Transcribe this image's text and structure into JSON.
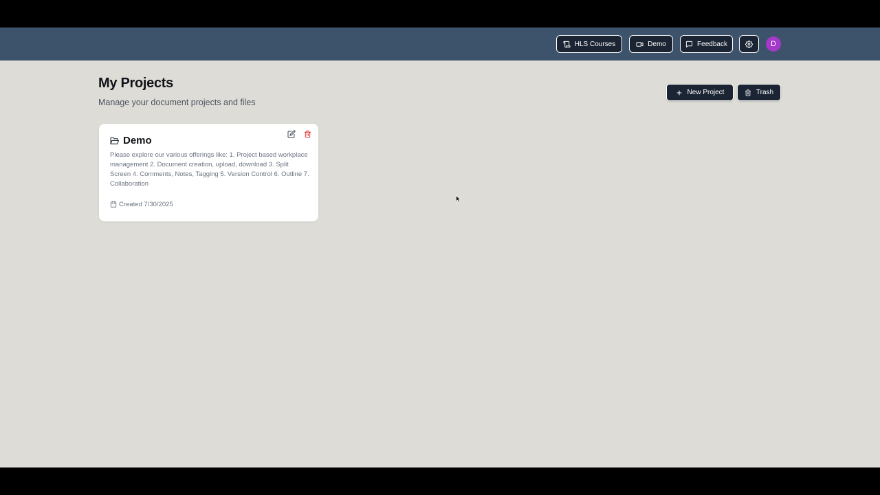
{
  "header": {
    "hls_courses_label": "HLS Courses",
    "demo_label": "Demo",
    "feedback_label": "Feedback",
    "avatar_initial": "D"
  },
  "page": {
    "title": "My Projects",
    "subtitle": "Manage your document projects and files",
    "new_project_label": "New Project",
    "trash_label": "Trash"
  },
  "projects": [
    {
      "title": "Demo",
      "description": "Please explore our various offerings like: 1. Project based workplace management 2. Document creation, upload, download 3. Split Screen 4. Comments, Notes, Tagging 5. Version Control 6. Outline 7. Collaboration",
      "created": "Created 7/30/2025"
    }
  ],
  "colors": {
    "topbar": "#3d526b",
    "background": "#dddcd6",
    "button_dark": "#1b2433",
    "avatar": "#a338c9",
    "delete_red": "#dc2626"
  },
  "icons": {
    "hls_courses": "scroll-icon",
    "demo": "video-icon",
    "feedback": "message-square-icon",
    "settings": "gear-icon",
    "new_project": "plus-icon",
    "trash": "trash-icon",
    "card_folder": "folder-open-icon",
    "card_edit": "edit-icon",
    "card_delete": "trash-icon",
    "card_created": "calendar-icon"
  }
}
